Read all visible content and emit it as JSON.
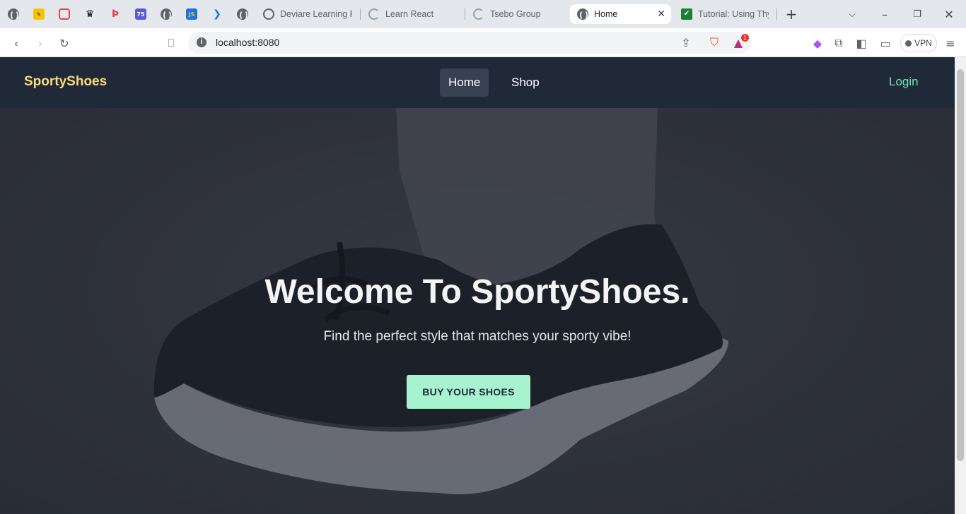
{
  "browser": {
    "tabs": [
      {
        "title": "Deviare Learning Pl",
        "icon": "deviare-icon"
      },
      {
        "title": "Learn React",
        "icon": "loading-icon"
      },
      {
        "title": "Tsebo Group",
        "icon": "loading-icon"
      },
      {
        "title": "Home",
        "icon": "globe-icon",
        "active": true
      },
      {
        "title": "Tutorial: Using Thy",
        "icon": "checkmark-icon"
      }
    ],
    "pinned_badge_75": "75",
    "pinned_badge_js": "JS",
    "address": "localhost:8080",
    "notification_count": "1",
    "vpn_label": "VPN"
  },
  "site": {
    "brand": "SportyShoes",
    "nav": {
      "home": "Home",
      "shop": "Shop",
      "login": "Login"
    },
    "hero": {
      "title": "Welcome To SportyShoes.",
      "subtitle": "Find the perfect style that matches your sporty vibe!",
      "cta": "BUY YOUR SHOES"
    },
    "colors": {
      "navbar": "#1f2937",
      "brand": "#fcd97a",
      "login": "#6ee7b7",
      "cta": "#a7f3d0"
    }
  }
}
